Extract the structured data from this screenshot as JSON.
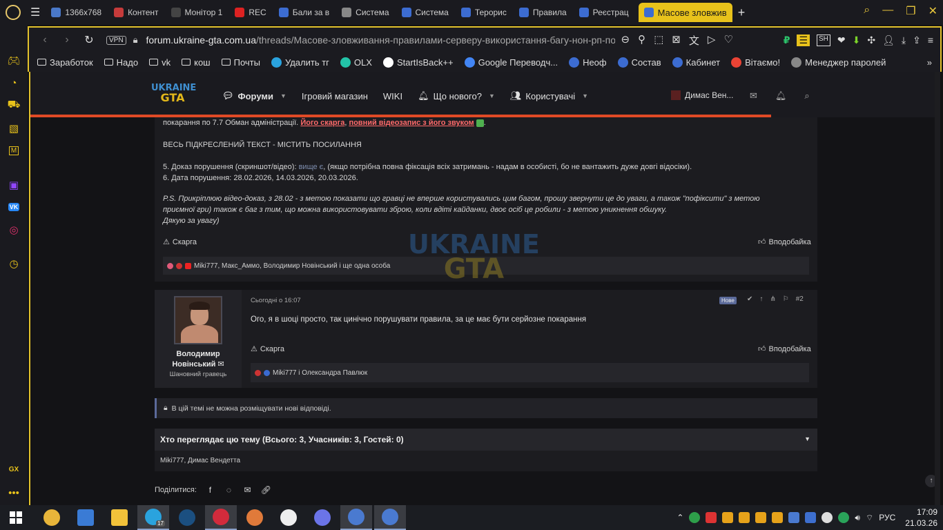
{
  "browser": {
    "tabs": [
      {
        "label": "1366x768",
        "color": "#4a78c8"
      },
      {
        "label": "Контент",
        "color": "#c63b3b"
      },
      {
        "label": "Монітор 1",
        "color": "#444"
      },
      {
        "label": "REC",
        "color": "#d22"
      },
      {
        "label": "Бали за в",
        "color": "#3c6cd1"
      },
      {
        "label": "Система",
        "color": "#888"
      },
      {
        "label": "Система",
        "color": "#3c6cd1"
      },
      {
        "label": "Терорис",
        "color": "#3c6cd1"
      },
      {
        "label": "Правила",
        "color": "#3c6cd1"
      },
      {
        "label": "Реєстрац",
        "color": "#3c6cd1"
      }
    ],
    "active_tab": "Масове зловжив",
    "accent_color": "#e3c22c"
  },
  "address": {
    "vpn": "VPN",
    "url_domain": "forum.ukraine-gta.com.ua",
    "url_path": "/threads/Масове-зловживання-правилами-серверу-використання-багу-нон-рп-пов"
  },
  "bookmarks": [
    {
      "label": "Заработок",
      "type": "folder"
    },
    {
      "label": "Надо",
      "type": "folder"
    },
    {
      "label": "vk",
      "type": "folder"
    },
    {
      "label": "кош",
      "type": "folder"
    },
    {
      "label": "Почты",
      "type": "folder"
    },
    {
      "label": "Удалить тг",
      "type": "site",
      "color": "#2aa3de"
    },
    {
      "label": "OLX",
      "type": "site",
      "color": "#23c4a8"
    },
    {
      "label": "StartIsBack++",
      "type": "site",
      "color": "#ffffff"
    },
    {
      "label": "Google Переводч...",
      "type": "site",
      "color": "#4285f4"
    },
    {
      "label": "Неоф",
      "type": "site",
      "color": "#3c6cd1"
    },
    {
      "label": "Состав",
      "type": "site",
      "color": "#3c6cd1"
    },
    {
      "label": "Кабинет",
      "type": "site",
      "color": "#3c6cd1"
    },
    {
      "label": "Вітаємо!",
      "type": "site",
      "color": "#ea4335"
    },
    {
      "label": "Менеджер паролей",
      "type": "site",
      "color": "#888"
    }
  ],
  "sidebar": {
    "gx_label": "GX",
    "icons": [
      "gamepad-icon",
      "speedometer-icon",
      "bag-icon",
      "hot-tab-icon",
      "m-icon",
      "twitch-icon",
      "vk-icon",
      "instagram-icon",
      "clock-icon"
    ]
  },
  "forum": {
    "logo_line1": "UKRAINE",
    "logo_line2": "GTA",
    "nav": [
      {
        "label": "Форуми",
        "has_dropdown": true,
        "active": true
      },
      {
        "label": "Ігровий магазин",
        "has_dropdown": false,
        "active": false
      },
      {
        "label": "WIKI",
        "has_dropdown": false,
        "active": false
      },
      {
        "label": "Що нового?",
        "has_dropdown": true,
        "active": false
      },
      {
        "label": "Користувачі",
        "has_dropdown": true,
        "active": false
      }
    ],
    "user_name": "Димас Вен...",
    "accent_red": "#e04a26"
  },
  "post1": {
    "line1_prefix": "покарання по 7.7 Обман адміністрації.",
    "line1_link1": "Його скарга",
    "line1_sep": ", ",
    "line1_link2": "повний відеозапис з його звуком",
    "line2": "ВЕСЬ ПІДКРЕСЛЕНИЙ ТЕКСТ - МІСТИТЬ ПОСИЛАННЯ",
    "line3_prefix": "5. Доказ порушення (скриншот/відео):",
    "line3_link": "вище є",
    "line3_suffix": ", (якщо потрібна повна фіксація всіх затримань - надам в особисті, бо не вантажить дуже довгі відосіки).",
    "line4": "6. Дата порушення: 28.02.2026, 14.03.2026, 20.03.2026.",
    "ps1": "P.S. Прикріплюю відео-доказ, з 28.02 - з метою показати що гравці не вперше користувались цим багом, прошу звернути це до уваги, а також \"пофіксити\" з метою",
    "ps2": "приємної гри) також є баг з тим, що можна використовувати зброю, коли вдіті кайданки, двоє осіб це робили - з метою уникнення обшуку.",
    "ps3": "Дякую за увагу)",
    "report": "Скарга",
    "like": "Вподобайка",
    "reactions": "Miki777, Макс_Аммо, Володимир Новінський і ще одна особа"
  },
  "post2": {
    "author": "Володимир Новінський",
    "author_title": "Шановний гравець",
    "time": "Сьогодні о 16:07",
    "badge": "Нове",
    "number": "#2",
    "body": "Ого, я в шоці просто, так цинічно порушувати правила, за це має бути серйозне покарання",
    "report": "Скарга",
    "like": "Вподобайка",
    "reactions": "Miki777 і Олександра Павлюк"
  },
  "locked_notice": "В цій темі не можна розміщувати нові відповіді.",
  "viewers": {
    "title": "Хто переглядає цю тему (Всього: 3, Учасників: 3, Гостей: 0)",
    "list": "Miki777, Димас Вендетта"
  },
  "share": {
    "label": "Поділитися:"
  },
  "watermark": {
    "line1": "UKRAINE",
    "line2": "GTA"
  },
  "taskbar": {
    "apps": [
      {
        "name": "chrome",
        "color": "#e8b53a",
        "open": false
      },
      {
        "name": "calculator",
        "color": "#3a7bd5",
        "open": false
      },
      {
        "name": "explorer",
        "color": "#f2c23a",
        "open": false
      },
      {
        "name": "telegram",
        "color": "#2aa3de",
        "open": true
      },
      {
        "name": "steam",
        "color": "#1b4f80",
        "open": false
      },
      {
        "name": "opera-gx",
        "color": "#d22b3c",
        "open": true
      },
      {
        "name": "paint",
        "color": "#e07a3a",
        "open": false
      },
      {
        "name": "logitech",
        "color": "#eee",
        "open": false
      },
      {
        "name": "discord",
        "color": "#6b74e8",
        "open": false
      },
      {
        "name": "gta-launcher-1",
        "color": "#4a7ad0",
        "open": true
      },
      {
        "name": "gta-launcher-2",
        "color": "#4a7ad0",
        "open": true
      }
    ],
    "telegram_badge": "17",
    "lang": "РУС",
    "time": "17:09",
    "date": "21.03.26"
  }
}
